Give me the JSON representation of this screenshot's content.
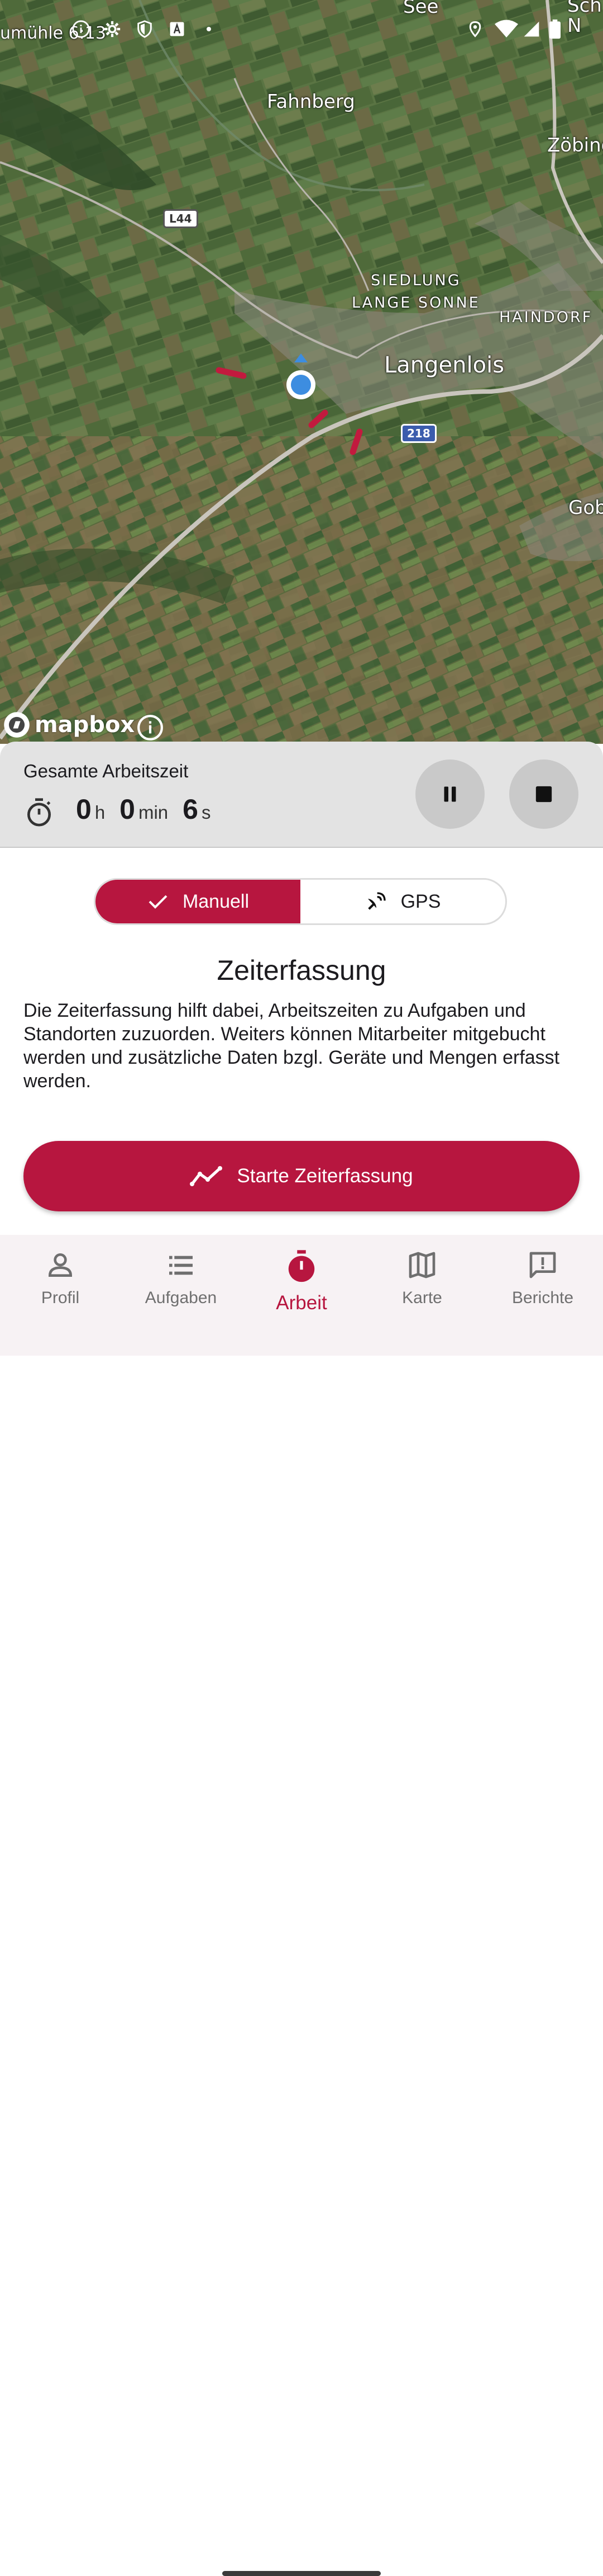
{
  "status_bar": {
    "time_partial": "umühle 6:13",
    "icons": [
      "info-icon",
      "settings-icon",
      "shield-icon",
      "font-icon",
      "dot-icon",
      "location-icon",
      "wifi-icon",
      "signal-icon",
      "battery-icon"
    ]
  },
  "map": {
    "labels": {
      "see": "See",
      "sch": "Sch\nN",
      "fahnberg": "Fahnberg",
      "zoebing": "Zöbing",
      "siedlung": "SIEDLUNG\nLANGE SONNE",
      "haindorf": "HAINDORF",
      "langenlois": "Langenlois",
      "gob": "Gob"
    },
    "road_l44": "L44",
    "road_218": "218",
    "attribution": "mapbox",
    "colors": {
      "route": "#c21a3e",
      "user_dot": "#3d8de0"
    }
  },
  "timer": {
    "title": "Gesamte Arbeitszeit",
    "hours": "0",
    "hours_unit": "h",
    "minutes": "0",
    "minutes_unit": "min",
    "seconds": "6",
    "seconds_unit": "s"
  },
  "mode_toggle": {
    "manual_label": "Manuell",
    "gps_label": "GPS",
    "selected": "Manuell"
  },
  "section": {
    "title": "Zeiterfassung",
    "description": "Die Zeiterfassung hilft dabei, Arbeitszeiten zu Aufgaben und Standorten zuzuorden. Weiters können Mitarbeiter mitgebucht werden und zusätzliche Daten bzgl. Geräte und Mengen erfasst werden."
  },
  "start_button": {
    "label": "Starte Zeiterfassung"
  },
  "bottom_nav": {
    "items": [
      {
        "label": "Profil",
        "icon": "person-icon"
      },
      {
        "label": "Aufgaben",
        "icon": "list-icon"
      },
      {
        "label": "Arbeit",
        "icon": "stopwatch-icon"
      },
      {
        "label": "Karte",
        "icon": "map-icon"
      },
      {
        "label": "Berichte",
        "icon": "report-icon"
      }
    ],
    "active": "Arbeit"
  },
  "colors": {
    "accent": "#b7163f",
    "panel": "#e3e3e3",
    "nav_bg": "#f7f2f4"
  }
}
